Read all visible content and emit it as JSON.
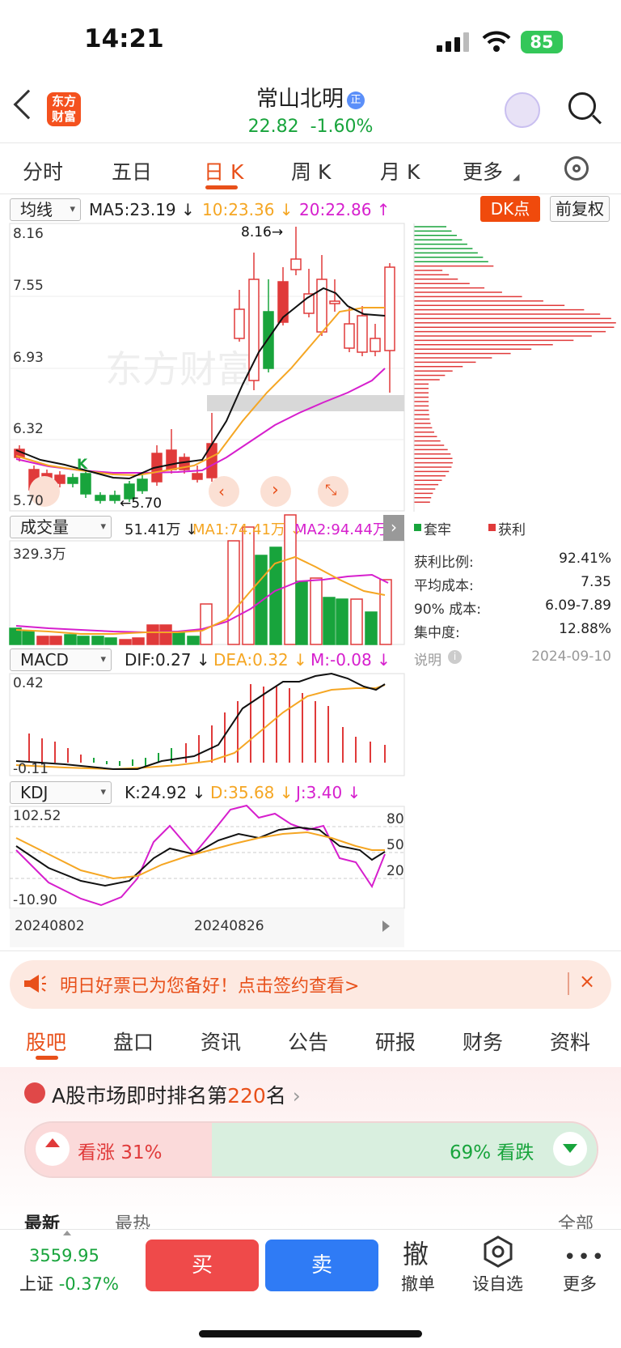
{
  "status": {
    "time": "14:21",
    "battery": "85"
  },
  "header": {
    "logo": "东方财富",
    "stock_name": "常山北明",
    "badge": "正",
    "price": "22.82",
    "change": "-1.60%"
  },
  "period_tabs": [
    "分时",
    "五日",
    "日 K",
    "周 K",
    "月 K",
    "更多"
  ],
  "ma_row": {
    "selector": "均线",
    "ma5": "MA5:23.19 ↓",
    "ma10": "10:23.36 ↓",
    "ma20": "20:22.86 ↑",
    "dk": "DK点",
    "fq": "前复权"
  },
  "kline": {
    "y_labels": [
      "8.16",
      "7.55",
      "6.93",
      "6.32",
      "5.70"
    ],
    "high_marker": "8.16→",
    "low_marker": "←5.70",
    "k_marker": "K",
    "watermark": "东方财富",
    "colors": {
      "up": "#e03a3a",
      "down": "#18a43c",
      "ma5": "#111111",
      "ma10": "#f5a623",
      "ma20": "#d61fcd"
    }
  },
  "volume_row": {
    "selector": "成交量",
    "value": "51.41万 ↓",
    "ma1": "MA1:74.41万 ↓",
    "ma2": "MA2:94.44万 ↓",
    "max_label": "329.3万"
  },
  "macd_row": {
    "selector": "MACD",
    "dif": "DIF:0.27 ↓",
    "dea": "DEA:0.32 ↓",
    "m": "M:-0.08 ↓",
    "top": "0.42",
    "bottom": "-0.11"
  },
  "kdj_row": {
    "selector": "KDJ",
    "k": "K:24.92 ↓",
    "d": "D:35.68 ↓",
    "j": "J:3.40 ↓",
    "top": "102.52",
    "bottom": "-10.90",
    "levels": [
      "80",
      "50",
      "20"
    ]
  },
  "dates": [
    "20240802",
    "20240826"
  ],
  "chips": {
    "legend_trapped": "套牢",
    "legend_profit": "获利",
    "stats": [
      {
        "label": "获利比例:",
        "value": "92.41%"
      },
      {
        "label": "平均成本:",
        "value": "7.35"
      },
      {
        "label": "90% 成本:",
        "value": "6.09-7.89"
      },
      {
        "label": "集中度:",
        "value": "12.88%"
      }
    ],
    "note": "说明",
    "date": "2024-09-10"
  },
  "banner": {
    "text": "明日好票已为您备好！点击签约查看>",
    "close": "×"
  },
  "section_tabs": [
    "股吧",
    "盘口",
    "资讯",
    "公告",
    "研报",
    "财务",
    "资料"
  ],
  "rank": {
    "prefix": "A股市场即时排名第",
    "num": "220",
    "suffix": "名",
    "arrow": "›"
  },
  "vote": {
    "up": "看涨 31%",
    "down": "69% 看跌"
  },
  "sort": {
    "latest": "最新",
    "hot": "最热",
    "all": "全部"
  },
  "bottom": {
    "index_value": "3559.95",
    "index_name": "上证",
    "index_change": "-0.37%",
    "buy": "买",
    "sell": "卖",
    "cancel_big": "撤",
    "cancel": "撤单",
    "watch": "设自选",
    "more": "更多"
  }
}
